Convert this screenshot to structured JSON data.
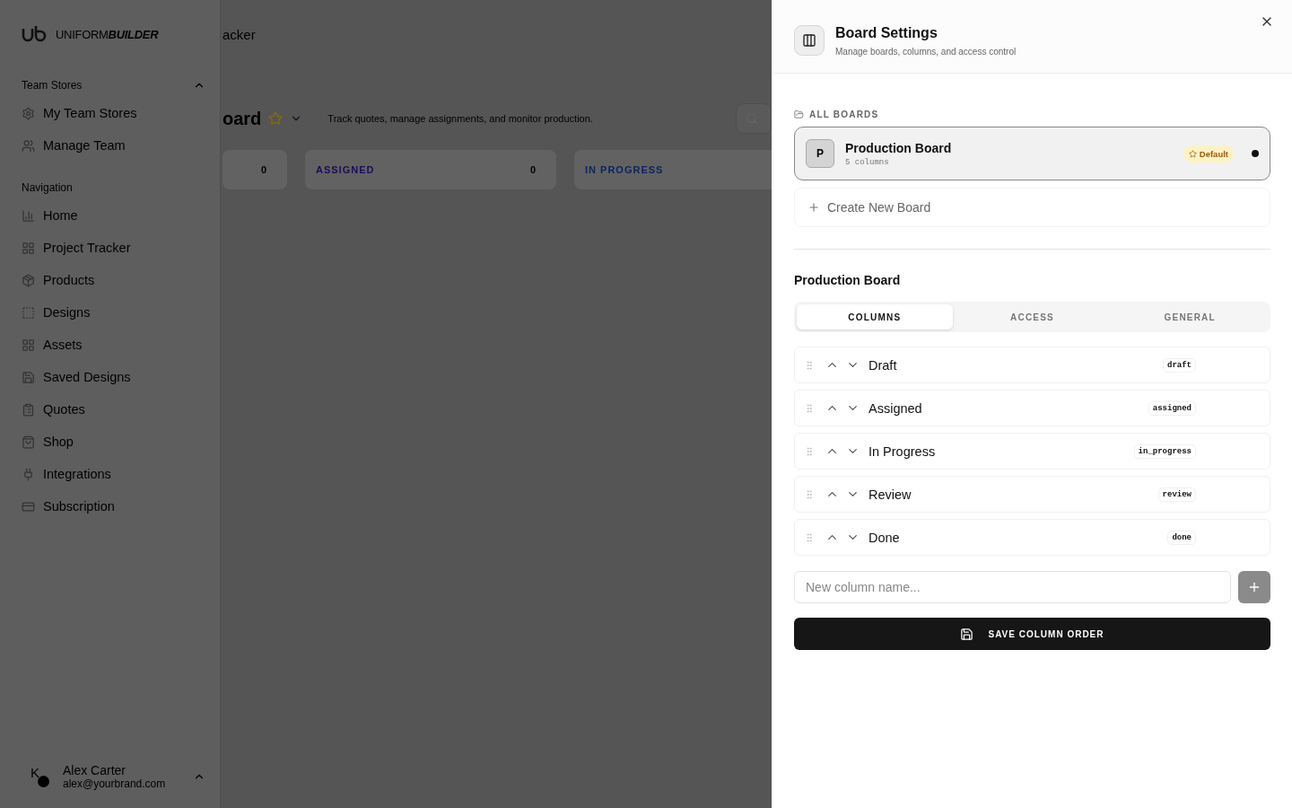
{
  "logo": {
    "text": "UNIFORM**BUILDER**"
  },
  "sidebar": {
    "team_stores": {
      "title": "Team Stores",
      "expanded": true,
      "items": [
        {
          "label": "My Team Stores"
        },
        {
          "label": "Manage Team"
        }
      ]
    },
    "navigation": {
      "title": "Navigation",
      "items": [
        {
          "label": "Home"
        },
        {
          "label": "Project Tracker"
        },
        {
          "label": "Products"
        },
        {
          "label": "Designs"
        },
        {
          "label": "Assets"
        },
        {
          "label": "Saved Designs"
        },
        {
          "label": "Quotes"
        },
        {
          "label": "Shop"
        },
        {
          "label": "Integrations"
        },
        {
          "label": "Subscription"
        }
      ]
    },
    "user": {
      "initial": "K",
      "name": "Alex Carter",
      "email": "alex@yourbrand.com"
    }
  },
  "header": {
    "breadcrumb": "acker",
    "title": "oard",
    "subtitle": "Track quotes, manage assignments, and monitor production."
  },
  "board_columns": [
    {
      "count": "0"
    },
    {
      "title": "ASSIGNED",
      "count": "0",
      "color": "#1e0b5c"
    },
    {
      "title": "IN PROGRESS",
      "color": "#0b2466"
    }
  ],
  "panel": {
    "title": "Board Settings",
    "subtitle": "Manage boards, columns, and access control",
    "boards_label": "ALL BOARDS",
    "boards": [
      {
        "initial": "P",
        "name": "Production Board",
        "meta": "5 columns",
        "badge": "Default",
        "selected": true
      }
    ],
    "create_label": "Create New Board",
    "section_title": "Production Board",
    "tabs": [
      {
        "label": "COLUMNS",
        "selected": true
      },
      {
        "label": "ACCESS",
        "selected": false
      },
      {
        "label": "GENERAL",
        "selected": false
      }
    ],
    "columns": [
      {
        "name": "Draft",
        "key": "draft"
      },
      {
        "name": "Assigned",
        "key": "assigned"
      },
      {
        "name": "In Progress",
        "key": "in_progress"
      },
      {
        "name": "Review",
        "key": "review"
      },
      {
        "name": "Done",
        "key": "done"
      }
    ],
    "new_column_placeholder": "New column name...",
    "save_label": "SAVE COLUMN ORDER"
  }
}
